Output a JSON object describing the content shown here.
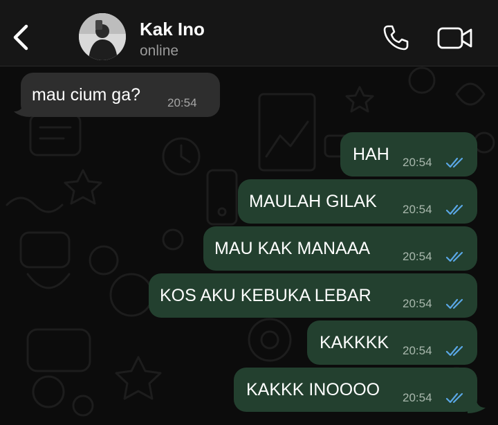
{
  "header": {
    "contact_name": "Kak Ino",
    "status": "online",
    "back_icon": "chevron-left-icon",
    "call_icon": "phone-icon",
    "video_icon": "video-camera-icon"
  },
  "colors": {
    "header_bg": "#161616",
    "chat_bg": "#0c0c0c",
    "incoming_bubble": "#2e2e2e",
    "outgoing_bubble": "#23402f",
    "read_ticks": "#5aa7e6"
  },
  "messages": [
    {
      "direction": "incoming",
      "text": "mau cium ga?",
      "time": "20:54"
    },
    {
      "direction": "outgoing",
      "text": "HAH",
      "time": "20:54",
      "status": "read"
    },
    {
      "direction": "outgoing",
      "text": "MAULAH GILAK",
      "time": "20:54",
      "status": "read"
    },
    {
      "direction": "outgoing",
      "text": "MAU KAK MANAAA",
      "time": "20:54",
      "status": "read"
    },
    {
      "direction": "outgoing",
      "text": "KOS AKU KEBUKA LEBAR",
      "time": "20:54",
      "status": "read"
    },
    {
      "direction": "outgoing",
      "text": "KAKKKK",
      "time": "20:54",
      "status": "read"
    },
    {
      "direction": "outgoing",
      "text": "KAKKK INOOOO",
      "time": "20:54",
      "status": "read"
    }
  ]
}
